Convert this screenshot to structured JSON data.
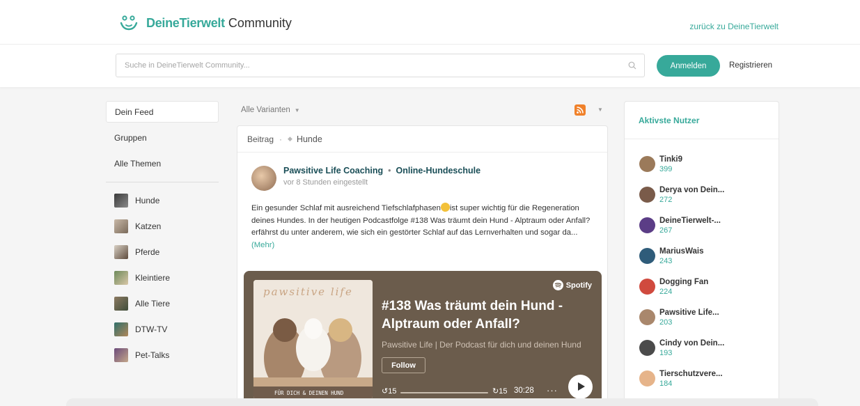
{
  "header": {
    "logo_brand": "DeineTierwelt",
    "logo_suffix": "Community",
    "back_link": "zurück zu DeineTierwelt"
  },
  "search": {
    "placeholder": "Suche in DeineTierwelt Community...",
    "value": ""
  },
  "auth": {
    "login_label": "Anmelden",
    "register_label": "Registrieren"
  },
  "sidebar": {
    "items": [
      {
        "label": "Dein Feed",
        "active": true
      },
      {
        "label": "Gruppen"
      },
      {
        "label": "Alle Themen"
      }
    ],
    "topics": [
      {
        "label": "Hunde",
        "icon": "dog-thumb"
      },
      {
        "label": "Katzen",
        "icon": "cat-thumb"
      },
      {
        "label": "Pferde",
        "icon": "horse-thumb"
      },
      {
        "label": "Kleintiere",
        "icon": "small-pets-thumb"
      },
      {
        "label": "Alle Tiere",
        "icon": "all-animals-thumb"
      },
      {
        "label": "DTW-TV",
        "icon": "tv-thumb"
      },
      {
        "label": "Pet-Talks",
        "icon": "pet-talks-thumb"
      }
    ]
  },
  "feed": {
    "filter_label": "Alle Varianten",
    "post": {
      "type_label": "Beitrag",
      "topic": "Hunde",
      "author": "Pawsitive Life Coaching",
      "separator": "•",
      "school": "Online-Hundeschule",
      "time": "vor 8 Stunden eingestellt",
      "text_before_emoji": "Ein gesunder Schlaf mit ausreichend Tiefschlafphasen",
      "text_after_emoji": "ist super wichtig für die Regeneration deines Hundes. In der heutigen Podcastfolge #138 Was träumt dein Hund - Alptraum oder Anfall?erfährst du unter anderem, wie sich ein gestörter Schlaf auf das Lernverhalten und sogar da...",
      "more_label": "(Mehr)"
    },
    "player": {
      "brand": "Spotify",
      "cover_title": "pawsitive life",
      "cover_caption": "FÜR DICH & DEINEN HUND",
      "episode_title": "#138 Was träumt dein Hund - Alptraum oder Anfall?",
      "show_name": "Pawsitive Life | Der Podcast für dich und deinen Hund",
      "follow_label": "Follow",
      "skip_back": "15",
      "skip_forward": "15",
      "duration": "30:28",
      "progress": 0,
      "more_label": "···"
    }
  },
  "active_users": {
    "title": "Aktivste Nutzer",
    "users": [
      {
        "name": "Tinki9",
        "score": "399",
        "avatar_color": "#9b7a5a"
      },
      {
        "name": "Derya von Dein...",
        "score": "272",
        "avatar_color": "#7a5b4a"
      },
      {
        "name": "DeineTierwelt-...",
        "score": "267",
        "avatar_color": "#5b3d86"
      },
      {
        "name": "MariusWais",
        "score": "243",
        "avatar_color": "#2f5c7a"
      },
      {
        "name": "Dogging Fan",
        "score": "224",
        "avatar_color": "#d04a3e"
      },
      {
        "name": "Pawsitive Life...",
        "score": "203",
        "avatar_color": "#a9876c"
      },
      {
        "name": "Cindy von Dein...",
        "score": "193",
        "avatar_color": "#4b4b4b"
      },
      {
        "name": "Tierschutzvere...",
        "score": "184",
        "avatar_color": "#e6b48a"
      }
    ]
  },
  "colors": {
    "accent": "#37a99a",
    "player_bg": "#6b5c4c",
    "rss": "#f0812a"
  }
}
